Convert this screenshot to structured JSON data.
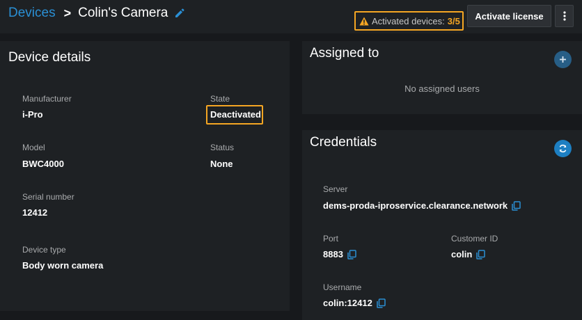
{
  "breadcrumb": {
    "root": "Devices",
    "current": "Colin's Camera"
  },
  "header": {
    "activated_label": "Activated devices:",
    "activated_count": "3/5",
    "license_button": "Activate license"
  },
  "details": {
    "title": "Device details",
    "manufacturer_label": "Manufacturer",
    "manufacturer_value": "i-Pro",
    "state_label": "State",
    "state_value": "Deactivated",
    "model_label": "Model",
    "model_value": "BWC4000",
    "status_label": "Status",
    "status_value": "None",
    "serial_label": "Serial number",
    "serial_value": "12412",
    "type_label": "Device type",
    "type_value": "Body worn camera"
  },
  "assigned": {
    "title": "Assigned to",
    "empty_text": "No assigned users"
  },
  "credentials": {
    "title": "Credentials",
    "server_label": "Server",
    "server_value": "dems-proda-iproservice.clearance.network",
    "port_label": "Port",
    "port_value": "8883",
    "customer_label": "Customer ID",
    "customer_value": "colin",
    "username_label": "Username",
    "username_value": "colin:12412"
  },
  "icons": {
    "edit": "pencil-icon",
    "warning": "warning-icon",
    "more": "vertical-dots-icon",
    "add": "plus-icon",
    "refresh": "refresh-icon",
    "copy": "copy-icon"
  },
  "colors": {
    "accent": "#2a8fd4",
    "warning": "#f5a623",
    "round_button": "#1d7fc2",
    "round_button_muted": "#275e86"
  }
}
